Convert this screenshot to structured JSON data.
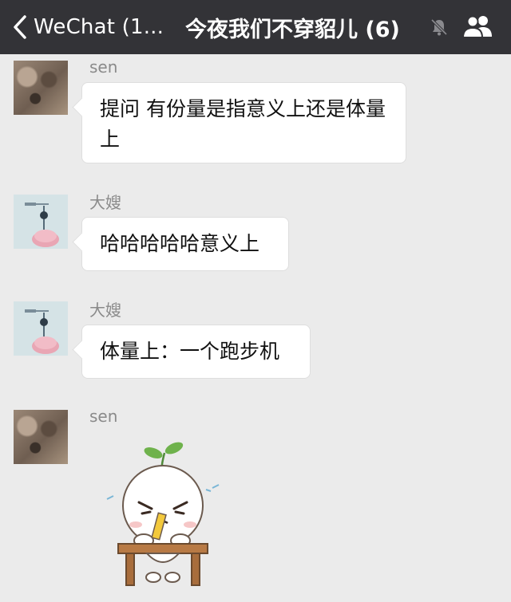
{
  "header": {
    "back_label": "WeChat (1...",
    "title": "今夜我们不穿貂儿 (6)"
  },
  "messages": [
    {
      "sender": "sen",
      "text": "提问 有份量是指意义上还是体量上"
    },
    {
      "sender": "大嫂",
      "text": "哈哈哈哈哈意义上"
    },
    {
      "sender": "大嫂",
      "text": "体量上：一个跑步机"
    },
    {
      "sender": "sen",
      "text": ""
    }
  ],
  "colors": {
    "header_bg": "#333337",
    "chat_bg": "#ebebeb",
    "bubble_bg": "#ffffff"
  },
  "icons": [
    "chevron-left-icon",
    "mute-bell-icon",
    "group-members-icon"
  ]
}
